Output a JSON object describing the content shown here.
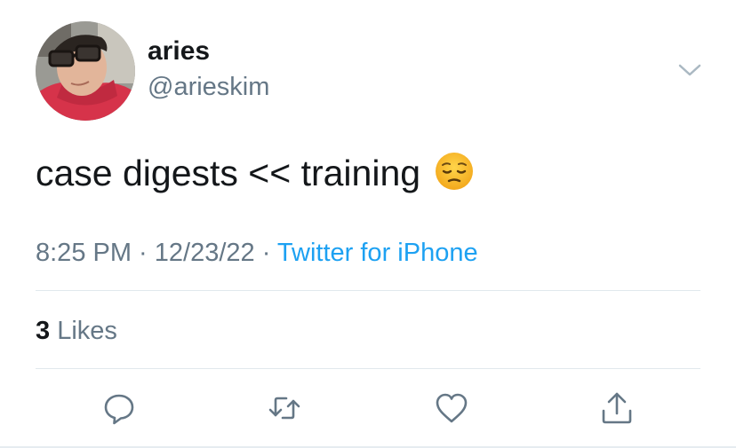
{
  "author": {
    "display_name": "aries",
    "handle": "@arieskim",
    "avatar_icon": "profile-photo"
  },
  "tweet": {
    "text": "case digests << training",
    "emoji": "pensive-face-emoji"
  },
  "meta": {
    "time": "8:25 PM",
    "separator": " · ",
    "date": "12/23/22",
    "source": "Twitter for iPhone"
  },
  "stats": {
    "likes_count": "3",
    "likes_label": "Likes"
  },
  "actions": {
    "reply_icon": "reply-icon",
    "retweet_icon": "retweet-icon",
    "like_icon": "heart-icon",
    "share_icon": "share-icon"
  },
  "colors": {
    "text": "#14171a",
    "secondary": "#657786",
    "link": "#1da1f2",
    "divider": "#e1e8ed"
  }
}
